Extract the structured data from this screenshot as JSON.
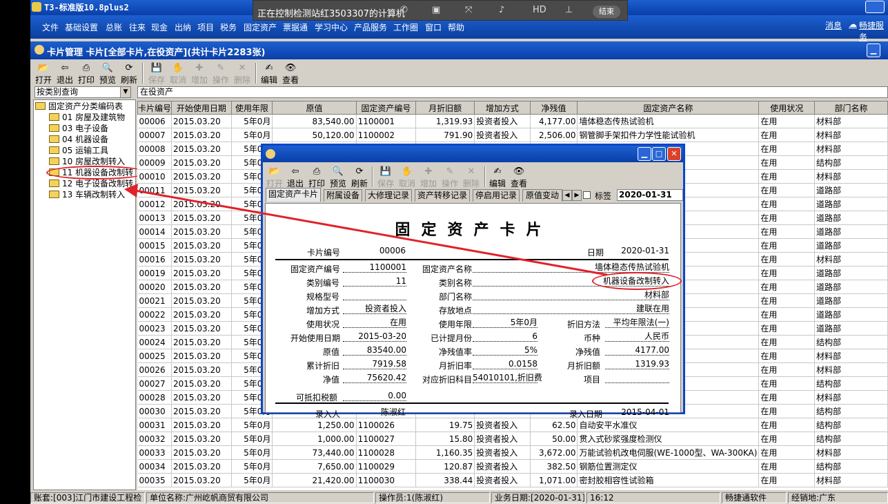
{
  "window": {
    "title": "T3-标准版10.8plus2"
  },
  "remote": {
    "text": "正在控制检测站红3503307的计算机",
    "end_label": "结束",
    "icons": [
      "phone-icon",
      "screen-icon",
      "fullscreen-icon",
      "volume-icon",
      "hd-icon",
      "pin-icon"
    ],
    "icon_glyphs": [
      "✆",
      "▣",
      "⤧",
      "♪",
      "HD",
      "⊥"
    ]
  },
  "menu": {
    "items": [
      "文件",
      "基础设置",
      "总账",
      "往来",
      "现金",
      "出纳",
      "项目",
      "税务",
      "固定资产",
      "票据通",
      "学习中心",
      "产品服务",
      "工作圈",
      "窗口",
      "帮助"
    ],
    "right": [
      "消息",
      "畅捷服务"
    ]
  },
  "doc": {
    "title": "卡片管理  卡片[全部卡片,在役资产](共计卡片2283张)"
  },
  "toolbar": {
    "items": [
      {
        "label": "打开",
        "glyph": "📂",
        "icon": "open-icon",
        "enabled": true
      },
      {
        "label": "退出",
        "glyph": "⇦",
        "icon": "exit-icon",
        "enabled": true
      },
      {
        "label": "打印",
        "glyph": "⎙",
        "icon": "print-icon",
        "enabled": true
      },
      {
        "label": "预览",
        "glyph": "🔍",
        "icon": "preview-icon",
        "enabled": true
      },
      {
        "label": "刷新",
        "glyph": "⟳",
        "icon": "refresh-icon",
        "enabled": true
      },
      {
        "label": "保存",
        "glyph": "💾",
        "icon": "save-icon",
        "enabled": false
      },
      {
        "label": "取消",
        "glyph": "✋",
        "icon": "cancel-icon",
        "enabled": false
      },
      {
        "label": "增加",
        "glyph": "✚",
        "icon": "add-icon",
        "enabled": false
      },
      {
        "label": "操作",
        "glyph": "✎",
        "icon": "operate-icon",
        "enabled": false
      },
      {
        "label": "删除",
        "glyph": "✕",
        "icon": "delete-icon",
        "enabled": false
      },
      {
        "label": "编辑",
        "glyph": "✍",
        "icon": "edit-icon",
        "enabled": true
      },
      {
        "label": "查看",
        "glyph": "👁",
        "icon": "view-icon",
        "enabled": true
      }
    ]
  },
  "query": {
    "selected": "按类别查询",
    "filter_label": "在役资产"
  },
  "tree": {
    "root": "固定资产分类编码表",
    "items": [
      "01 房屋及建筑物",
      "03 电子设备",
      "04 机器设备",
      "05 运输工具",
      "10 房屋改制转入",
      "11 机器设备改制转",
      "12 电子设备改制转",
      "13 车辆改制转入"
    ]
  },
  "grid": {
    "columns": [
      "卡片编号",
      "开始使用日期",
      "使用年限",
      "原值",
      "固定资产编号",
      "月折旧额",
      "增加方式",
      "净残值",
      "固定资产名称",
      "使用状况",
      "部门名称"
    ],
    "rows": [
      [
        "00006",
        "2015.03.20",
        "5年0月",
        "83,540.00",
        "1100001",
        "1,319.93",
        "投资者投入",
        "4,177.00",
        "墙体稳态传热试验机",
        "在用",
        "材料部"
      ],
      [
        "00007",
        "2015.03.20",
        "5年0月",
        "50,120.00",
        "1100002",
        "791.90",
        "投资者投入",
        "2,506.00",
        "钢管脚手架扣件力学性能试验机",
        "在用",
        "材料部"
      ],
      [
        "00008",
        "2015.03.20",
        "5年0月",
        "",
        "",
        "",
        "",
        "",
        "",
        "在用",
        "材料部"
      ],
      [
        "00009",
        "2015.03.20",
        "5年0月",
        "",
        "",
        "",
        "",
        "",
        "测仪",
        "在用",
        "结构部"
      ],
      [
        "00010",
        "2015.03.20",
        "5年0月",
        "",
        "",
        "",
        "",
        "",
        "比测试系统",
        "在用",
        "材料部"
      ],
      [
        "00011",
        "2015.03.20",
        "5年0月",
        "",
        "",
        "",
        "",
        "",
        "",
        "在用",
        "道路部"
      ],
      [
        "00012",
        "2015.03.20",
        "5年0月",
        "",
        "",
        "",
        "",
        "",
        "",
        "在用",
        "道路部"
      ],
      [
        "00013",
        "2015.03.20",
        "5年0月",
        "",
        "",
        "",
        "",
        "",
        "",
        "在用",
        "道路部"
      ],
      [
        "00014",
        "2015.03.20",
        "5年0月",
        "",
        "",
        "",
        "",
        "",
        "仪",
        "在用",
        "道路部"
      ],
      [
        "00015",
        "2015.03.20",
        "5年0月",
        "",
        "",
        "",
        "",
        "",
        "箱",
        "在用",
        "道路部"
      ],
      [
        "00016",
        "2015.03.20",
        "5年0月",
        "",
        "",
        "",
        "",
        "",
        "",
        "在用",
        "材料部"
      ],
      [
        "00019",
        "2015.03.20",
        "5年0月",
        "",
        "",
        "",
        "",
        "",
        "(钻芯法)",
        "在用",
        "道路部"
      ],
      [
        "00020",
        "2015.03.20",
        "5年0月",
        "",
        "",
        "",
        "",
        "",
        "",
        "在用",
        "道路部"
      ],
      [
        "00021",
        "2015.03.20",
        "5年0月",
        "",
        "",
        "",
        "",
        "",
        "",
        "在用",
        "道路部"
      ],
      [
        "00022",
        "2015.03.20",
        "5年0月",
        "",
        "",
        "",
        "",
        "",
        "",
        "在用",
        "道路部"
      ],
      [
        "00023",
        "2015.03.20",
        "5年0月",
        "",
        "",
        "",
        "",
        "",
        "",
        "在用",
        "道路部"
      ],
      [
        "00024",
        "2015.03.20",
        "5年0月",
        "",
        "",
        "",
        "",
        "",
        "检测仪",
        "在用",
        "结构部"
      ],
      [
        "00025",
        "2015.03.20",
        "5年0月",
        "",
        "",
        "",
        "",
        "",
        "",
        "在用",
        "材料部"
      ],
      [
        "00026",
        "2015.03.20",
        "5年0月",
        "",
        "",
        "",
        "",
        "",
        "系数检定系统",
        "在用",
        "材料部"
      ],
      [
        "00027",
        "2015.03.20",
        "5年0月",
        "",
        "",
        "",
        "",
        "",
        "",
        "在用",
        "结构部"
      ],
      [
        "00028",
        "2015.03.20",
        "5年0月",
        "",
        "",
        "",
        "",
        "",
        "",
        "在用",
        "材料部"
      ],
      [
        "00030",
        "2015.03.20",
        "5年0月",
        "",
        "",
        "",
        "",
        "",
        "",
        "在用",
        "结构部"
      ],
      [
        "00031",
        "2015.03.20",
        "5年0月",
        "1,250.00",
        "1100026",
        "19.75",
        "投资者投入",
        "62.50",
        "自动安平水准仪",
        "在用",
        "结构部"
      ],
      [
        "00032",
        "2015.03.20",
        "5年0月",
        "1,000.00",
        "1100027",
        "15.80",
        "投资者投入",
        "50.00",
        "贯入式砂浆强度检测仪",
        "在用",
        "结构部"
      ],
      [
        "00033",
        "2015.03.20",
        "5年0月",
        "73,440.00",
        "1100028",
        "1,160.35",
        "投资者投入",
        "3,672.00",
        "万能试验机改电伺服(WE-1000型、WA-300KA)",
        "在用",
        "材料部"
      ],
      [
        "00034",
        "2015.03.20",
        "5年0月",
        "7,650.00",
        "1100029",
        "120.87",
        "投资者投入",
        "382.50",
        "钢筋位置测定仪",
        "在用",
        "结构部"
      ],
      [
        "00035",
        "2015.03.20",
        "5年0月",
        "21,420.00",
        "1100030",
        "338.44",
        "投资者投入",
        "1,071.00",
        "密封胶相容性试验箱",
        "在用",
        "材料部"
      ]
    ]
  },
  "status": {
    "account": "账套:[003]江门市建设工程检",
    "company": "单位名称:广州屹帆商贸有限公司",
    "operator": "操作员:1(陈淑红)",
    "bizdate": "业务日期:[2020-01-31]",
    "time": "16:12",
    "vendor": "畅捷通软件",
    "region": "经销地:广东"
  },
  "card": {
    "tabs": [
      "固定资产卡片",
      "附属设备",
      "大修理记录",
      "资产转移记录",
      "停启用记录",
      "原值变动"
    ],
    "tag_label": "标签",
    "top_date": "2020-01-31",
    "heading": "固定资产卡片",
    "card_no_label": "卡片编号",
    "card_no": "00006",
    "date_label": "日期",
    "date": "2020-01-31",
    "f": {
      "asset_no_l": "固定资产编号",
      "asset_no": "1100001",
      "asset_name_l": "固定资产名称",
      "asset_name": "墙体稳态传热试验机",
      "cat_no_l": "类别编号",
      "cat_no": "11",
      "cat_name_l": "类别名称",
      "cat_name": "机器设备改制转入",
      "spec_l": "规格型号",
      "spec": "",
      "dept_l": "部门名称",
      "dept": "材料部",
      "add_l": "增加方式",
      "add": "投资者投入",
      "loc_l": "存放地点",
      "loc": "建联在用",
      "usage_l": "使用状况",
      "usage": "在用",
      "life_l": "使用年限",
      "life": "5年0月",
      "method_l": "折旧方法",
      "method": "平均年限法(一)",
      "start_l": "开始使用日期",
      "start": "2015-03-20",
      "months_l": "已计提月份",
      "months": "6",
      "cur_l": "币种",
      "cur": "人民币",
      "orig_l": "原值",
      "orig": "83540.00",
      "rate_l": "净残值率",
      "rate": "5%",
      "resid_l": "净残值",
      "resid": "4177.00",
      "accum_l": "累计折旧",
      "accum": "7919.58",
      "mrate_l": "月折旧率",
      "mrate": "0.0158",
      "mamt_l": "月折旧额",
      "mamt": "1319.93",
      "net_l": "净值",
      "net": "75620.42",
      "subj_l": "对应折旧科目",
      "subj": "54010101,折旧费",
      "proj_l": "项目",
      "proj": "",
      "tax_l": "可抵扣税额",
      "tax": "0.00",
      "entry_l": "录入人",
      "entry": "陈淑红",
      "edate_l": "录入日期",
      "edate": "2015-04-01"
    }
  },
  "colors": {
    "accent_blue": "#0a46c8",
    "annotation_red": "#e0222a"
  }
}
